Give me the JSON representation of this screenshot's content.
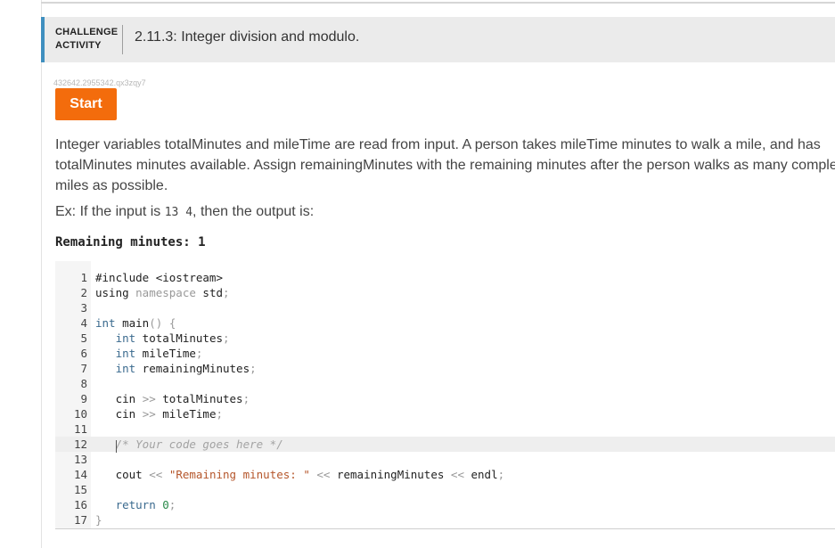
{
  "header": {
    "kind_line1": "CHALLENGE",
    "kind_line2": "ACTIVITY",
    "title": "2.11.3: Integer division and modulo."
  },
  "activity_id": "432642.2955342.qx3zqy7",
  "start_button": "Start",
  "prompt": {
    "text": "Integer variables totalMinutes and mileTime are read from input. A person takes mileTime minutes to walk a mile, and has totalMinutes minutes available. Assign remainingMinutes with the remaining minutes after the person walks as many complete miles as possible."
  },
  "example": {
    "prefix": "Ex: If the input is ",
    "input": "13 4",
    "suffix": ", then the output is:",
    "expected_output": "Remaining minutes: 1"
  },
  "editor": {
    "active_line": 12,
    "lines": [
      {
        "n": "1",
        "code": "#include <iostream>"
      },
      {
        "n": "2",
        "code": "using namespace std;"
      },
      {
        "n": "3",
        "code": ""
      },
      {
        "n": "4",
        "code": "int main() {"
      },
      {
        "n": "5",
        "code": "   int totalMinutes;"
      },
      {
        "n": "6",
        "code": "   int mileTime;"
      },
      {
        "n": "7",
        "code": "   int remainingMinutes;"
      },
      {
        "n": "8",
        "code": ""
      },
      {
        "n": "9",
        "code": "   cin >> totalMinutes;"
      },
      {
        "n": "10",
        "code": "   cin >> mileTime;"
      },
      {
        "n": "11",
        "code": ""
      },
      {
        "n": "12",
        "code": "   /* Your code goes here */"
      },
      {
        "n": "13",
        "code": ""
      },
      {
        "n": "14",
        "code": "   cout << \"Remaining minutes: \" << remainingMinutes << endl;"
      },
      {
        "n": "15",
        "code": ""
      },
      {
        "n": "16",
        "code": "   return 0;"
      },
      {
        "n": "17",
        "code": "}"
      }
    ]
  },
  "colors": {
    "accent": "#3f8fbf",
    "start_button": "#f36c0c",
    "header_bg": "#ebebeb"
  }
}
